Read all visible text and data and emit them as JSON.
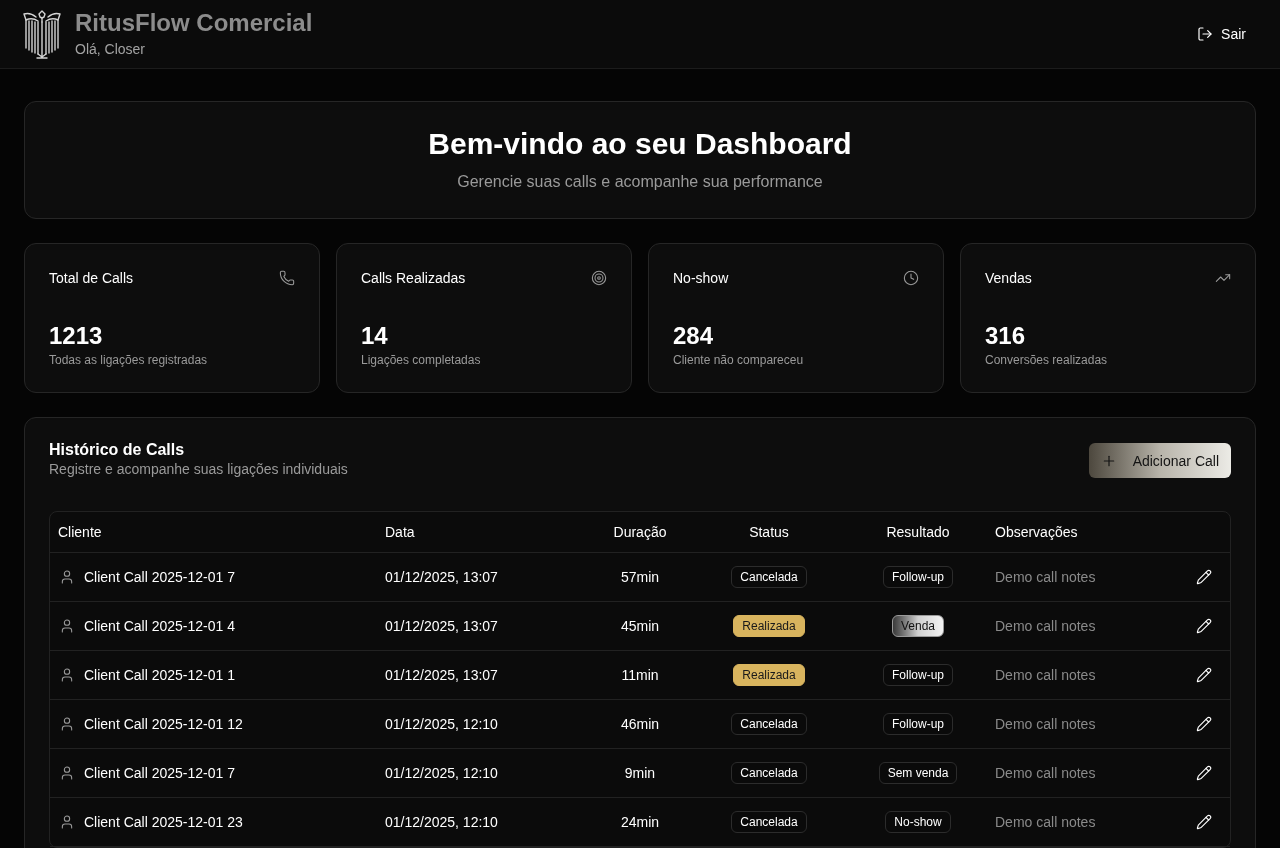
{
  "header": {
    "title": "RitusFlow Comercial",
    "greeting": "Olá, Closer",
    "logout_button": "Sair"
  },
  "welcome": {
    "title": "Bem-vindo ao seu Dashboard",
    "subtitle": "Gerencie suas calls e acompanhe sua performance"
  },
  "stats": [
    {
      "label": "Total de Calls",
      "value": "1213",
      "caption": "Todas as ligações registradas"
    },
    {
      "label": "Calls Realizadas",
      "value": "14",
      "caption": "Ligações completadas"
    },
    {
      "label": "No-show",
      "value": "284",
      "caption": "Cliente não compareceu"
    },
    {
      "label": "Vendas",
      "value": "316",
      "caption": "Conversões realizadas"
    }
  ],
  "history": {
    "title": "Histórico de Calls",
    "subtitle": "Registre e acompanhe suas ligações individuais",
    "add_button": "Adicionar Call",
    "table": {
      "columns": [
        "Cliente",
        "Data",
        "Duração",
        "Status",
        "Resultado",
        "Observações"
      ],
      "rows": [
        {
          "client": "Client Call 2025-12-01 7",
          "date": "01/12/2025, 13:07",
          "duration": "57min",
          "status": {
            "label": "Cancelada",
            "kind": "outline"
          },
          "result": {
            "label": "Follow-up",
            "kind": "outline"
          },
          "notes": "Demo call notes"
        },
        {
          "client": "Client Call 2025-12-01 4",
          "date": "01/12/2025, 13:07",
          "duration": "45min",
          "status": {
            "label": "Realizada",
            "kind": "highlight"
          },
          "result": {
            "label": "Venda",
            "kind": "gradient"
          },
          "notes": "Demo call notes"
        },
        {
          "client": "Client Call 2025-12-01 1",
          "date": "01/12/2025, 13:07",
          "duration": "11min",
          "status": {
            "label": "Realizada",
            "kind": "highlight"
          },
          "result": {
            "label": "Follow-up",
            "kind": "outline"
          },
          "notes": "Demo call notes"
        },
        {
          "client": "Client Call 2025-12-01 12",
          "date": "01/12/2025, 12:10",
          "duration": "46min",
          "status": {
            "label": "Cancelada",
            "kind": "outline"
          },
          "result": {
            "label": "Follow-up",
            "kind": "outline"
          },
          "notes": "Demo call notes"
        },
        {
          "client": "Client Call 2025-12-01 7",
          "date": "01/12/2025, 12:10",
          "duration": "9min",
          "status": {
            "label": "Cancelada",
            "kind": "outline"
          },
          "result": {
            "label": "Sem venda",
            "kind": "outline"
          },
          "notes": "Demo call notes"
        },
        {
          "client": "Client Call 2025-12-01 23",
          "date": "01/12/2025, 12:10",
          "duration": "24min",
          "status": {
            "label": "Cancelada",
            "kind": "outline"
          },
          "result": {
            "label": "No-show",
            "kind": "outline"
          },
          "notes": "Demo call notes"
        }
      ]
    }
  }
}
